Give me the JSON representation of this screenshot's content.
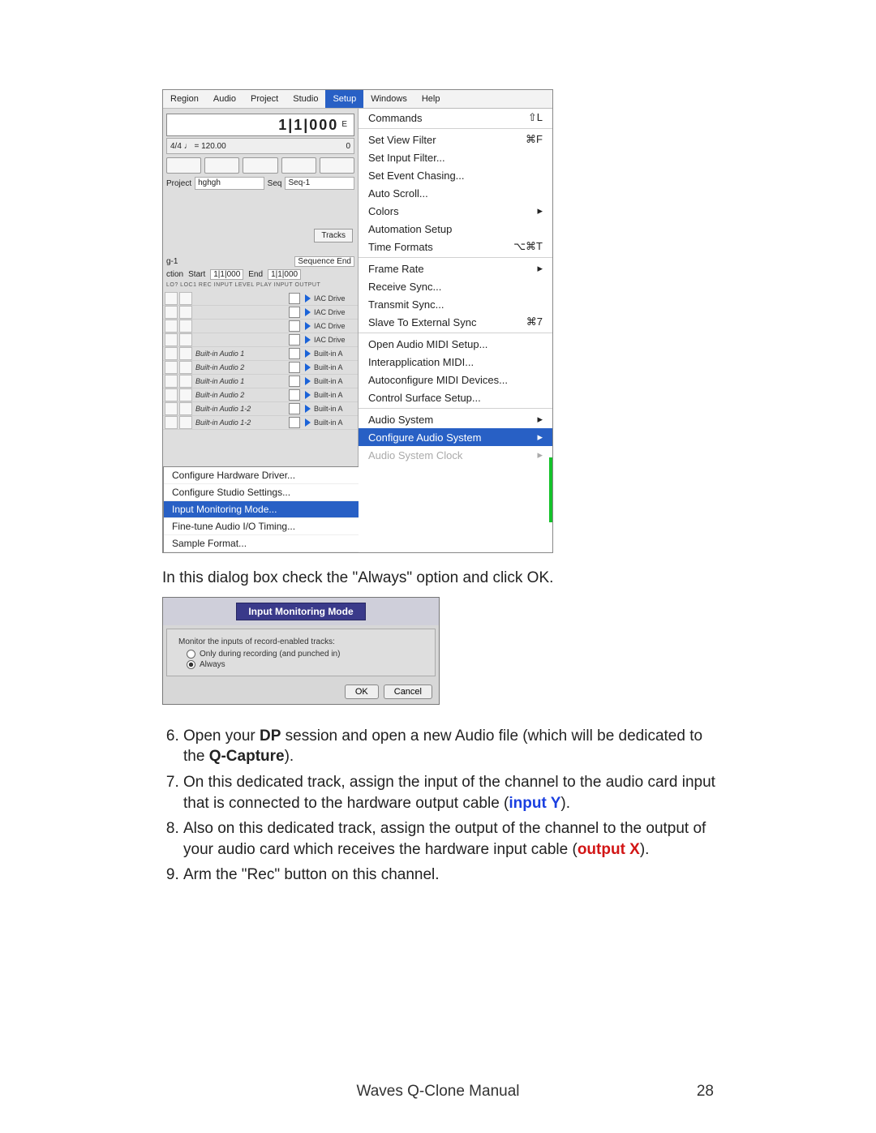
{
  "menubar": {
    "items": [
      "Region",
      "Audio",
      "Project",
      "Studio",
      "Setup",
      "Windows",
      "Help"
    ],
    "selected": "Setup"
  },
  "dp": {
    "counter": "1|1|000",
    "counter_suffix": "E",
    "tempo_left": "4/4  ♩ = 120.00",
    "tempo_right": "0",
    "proj_label": "Project",
    "proj_value": "hghgh",
    "seq_label": "Seq",
    "seq_value": "Seq-1",
    "tracks_btn": "Tracks",
    "seq_end": "Sequence End",
    "row_ction": "ction",
    "row_start": "Start",
    "row_start_val": "1|1|000",
    "row_end": "End",
    "row_end_val": "1|1|000",
    "mini_header": "LO?  LOC1  REC  INPUT                         LEVEL  PLAY  INPUT  OUTPUT",
    "track_rows": [
      {
        "name": "",
        "out": "IAC Drive"
      },
      {
        "name": "",
        "out": "IAC Drive"
      },
      {
        "name": "",
        "out": "IAC Drive"
      },
      {
        "name": "",
        "out": "IAC Drive"
      },
      {
        "name": "Built-in Audio 1",
        "out": "Built-in A"
      },
      {
        "name": "Built-in Audio 2",
        "out": "Built-in A"
      },
      {
        "name": "Built-in Audio 1",
        "out": "Built-in A"
      },
      {
        "name": "Built-in Audio 2",
        "out": "Built-in A"
      },
      {
        "name": "Built-in Audio 1-2",
        "out": "Built-in A"
      },
      {
        "name": "Built-in Audio 1-2",
        "out": "Built-in A"
      }
    ],
    "submenu": [
      "Configure Hardware Driver...",
      "Configure Studio Settings...",
      "Input Monitoring Mode...",
      "Fine-tune Audio I/O Timing...",
      "Sample Format..."
    ],
    "submenu_hl": 2
  },
  "setup_menu": [
    {
      "t": "Commands",
      "k": "⇧L"
    },
    {
      "sep": true
    },
    {
      "t": "Set View Filter",
      "k": "⌘F"
    },
    {
      "t": "Set Input Filter..."
    },
    {
      "t": "Set Event Chasing..."
    },
    {
      "t": "Auto Scroll..."
    },
    {
      "t": "Colors",
      "sub": true
    },
    {
      "t": "Automation Setup"
    },
    {
      "t": "Time Formats",
      "k": "⌥⌘T"
    },
    {
      "sep": true
    },
    {
      "t": "Frame Rate",
      "sub": true
    },
    {
      "t": "Receive Sync..."
    },
    {
      "t": "Transmit Sync..."
    },
    {
      "t": "Slave To External Sync",
      "k": "⌘7"
    },
    {
      "sep": true
    },
    {
      "t": "Open Audio MIDI Setup..."
    },
    {
      "t": "Interapplication MIDI..."
    },
    {
      "t": "Autoconfigure MIDI Devices..."
    },
    {
      "t": "Control Surface Setup..."
    },
    {
      "sep": true
    },
    {
      "t": "Audio System",
      "sub": true
    },
    {
      "t": "Configure Audio System",
      "sub": true,
      "hl": true
    },
    {
      "t": "Audio System Clock",
      "sub": true,
      "dim": true
    }
  ],
  "para1": "In this dialog box check the \"Always\" option and click OK.",
  "dialog": {
    "title": "Input Monitoring Mode",
    "label": "Monitor the inputs of record-enabled tracks:",
    "opt1": "Only during recording (and punched in)",
    "opt2": "Always",
    "ok": "OK",
    "cancel": "Cancel"
  },
  "steps": {
    "s6a": "Open your ",
    "s6b": "DP",
    "s6c": " session and open a new Audio file (which will be dedicated to the ",
    "s6d": "Q-Capture",
    "s6e": ").",
    "s7a": "On this dedicated track, assign the input of the channel to the audio card input that is connected to the hardware output cable (",
    "s7b": "input Y",
    "s7c": ").",
    "s8a": "Also on this dedicated track, assign the output of the channel to the output of your audio card which receives the hardware input cable (",
    "s8b": "output X",
    "s8c": ").",
    "s9": "Arm the \"Rec\" button on this channel."
  },
  "footer": {
    "title": "Waves Q-Clone Manual",
    "page": "28"
  }
}
